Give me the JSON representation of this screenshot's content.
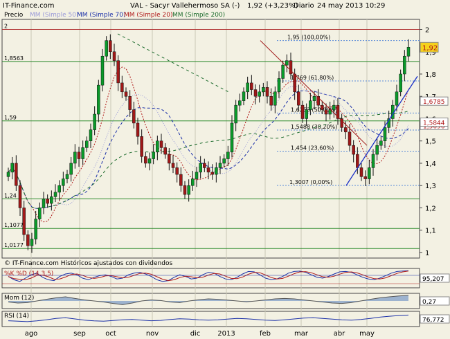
{
  "header": {
    "brand": "IT-Finance.com",
    "title": "VAL - Sacyr Vallehermoso SA (-)",
    "quote": "1,92 (+3,23%)",
    "period": "Diario",
    "date": "24 may 2013 10:29"
  },
  "legend": {
    "price": "Precio",
    "mm50": "MM (Simple 50)",
    "mm70": "MM (Simple 70)",
    "mm20": "MM (Simple 20)",
    "mm200": "MM (Simple 200)"
  },
  "colors": {
    "background": "#f3f1e3",
    "up": "#0a9a2a",
    "down": "#a01818",
    "mm50": "#9a9ad8",
    "mm70": "#1a2fa8",
    "mm20": "#b01818",
    "mm200": "#1c6b2c",
    "grid_red": "#b03030",
    "grid_green": "#2a8a2a",
    "support": "#1a2fc8",
    "price_tag": "#f6d21c"
  },
  "footer_note": "© IT-Finance.com  Históricos ajustados con dividendos",
  "chart_data": [
    {
      "type": "candlestick",
      "title": "VAL - Sacyr Vallehermoso SA (-)",
      "x_ticks": [
        "ago",
        "sep",
        "oct",
        "nov",
        "dic",
        "2013",
        "feb",
        "mar",
        "abr",
        "may"
      ],
      "y_ticks": [
        "2",
        "1,9",
        "1,8",
        "1,7",
        "1,6",
        "1,5",
        "1,4",
        "1,3",
        "1,2",
        "1,1",
        "1"
      ],
      "ylim": [
        0.975,
        2.045
      ],
      "last_price_label": "1,92",
      "level_labels": [
        {
          "label": "1,6785",
          "value": 1.6785
        },
        {
          "label": "1,5696",
          "value": 1.5696
        },
        {
          "label": "1,5844",
          "value": 1.5844
        }
      ],
      "horizontal_levels": [
        {
          "label": "2",
          "value": 2.0,
          "color": "#b03030"
        },
        {
          "label": "1,8563",
          "value": 1.8563,
          "color": "#2a8a2a"
        },
        {
          "label": "1,59",
          "value": 1.59,
          "color": "#2a8a2a"
        },
        {
          "label": "1,24",
          "value": 1.24,
          "color": "#2a8a2a"
        },
        {
          "label": "1,1077",
          "value": 1.1077,
          "color": "#2a8a2a"
        },
        {
          "label": "1,0177",
          "value": 1.0177,
          "color": "#2a8a2a"
        }
      ],
      "fibonacci": [
        {
          "label": "1,95 (100,00%)",
          "value": 1.95
        },
        {
          "label": "1,769 (61,80%)",
          "value": 1.769
        },
        {
          "label": "1,6253 (50,00%)",
          "value": 1.6253
        },
        {
          "label": "1,5488 (38,20%)",
          "value": 1.5488
        },
        {
          "label": "1,454 (23,60%)",
          "value": 1.454
        },
        {
          "label": "1,3007 (0,00%)",
          "value": 1.3007
        }
      ],
      "close_series": [
        1.36,
        1.4,
        1.3,
        1.2,
        1.08,
        1.03,
        1.06,
        1.15,
        1.2,
        1.24,
        1.22,
        1.25,
        1.27,
        1.3,
        1.33,
        1.35,
        1.4,
        1.45,
        1.42,
        1.47,
        1.5,
        1.55,
        1.62,
        1.75,
        1.88,
        1.95,
        1.9,
        1.86,
        1.76,
        1.72,
        1.7,
        1.64,
        1.58,
        1.52,
        1.43,
        1.4,
        1.42,
        1.45,
        1.5,
        1.47,
        1.44,
        1.4,
        1.38,
        1.35,
        1.3,
        1.26,
        1.3,
        1.33,
        1.36,
        1.4,
        1.38,
        1.36,
        1.35,
        1.38,
        1.4,
        1.42,
        1.45,
        1.58,
        1.66,
        1.68,
        1.72,
        1.76,
        1.73,
        1.7,
        1.72,
        1.74,
        1.7,
        1.66,
        1.72,
        1.78,
        1.84,
        1.86,
        1.8,
        1.72,
        1.66,
        1.6,
        1.64,
        1.68,
        1.7,
        1.66,
        1.64,
        1.62,
        1.64,
        1.66,
        1.6,
        1.56,
        1.54,
        1.48,
        1.44,
        1.38,
        1.34,
        1.33,
        1.38,
        1.44,
        1.48,
        1.5,
        1.56,
        1.6,
        1.66,
        1.72,
        1.8,
        1.88,
        1.92
      ]
    },
    {
      "type": "line",
      "title": "%K %D (14,3,5)",
      "series": [
        {
          "name": "%K"
        },
        {
          "name": "%D"
        }
      ],
      "last_value_label": "95,207",
      "values": [
        60,
        40,
        30,
        50,
        70,
        80,
        55,
        40,
        35,
        60,
        75,
        80,
        70,
        50,
        40,
        55,
        65,
        70,
        60,
        45,
        50,
        70,
        80,
        85,
        75,
        60,
        40,
        30,
        35,
        55,
        70,
        60,
        45,
        50,
        70,
        85,
        80,
        60,
        45,
        40,
        55,
        75,
        90,
        88,
        70,
        50,
        40,
        45,
        60,
        80,
        90,
        92,
        85,
        70,
        55,
        50,
        60,
        75,
        88,
        90,
        85,
        70,
        55,
        45,
        40,
        50,
        65,
        80,
        90,
        93,
        95
      ]
    },
    {
      "type": "area",
      "title": "Mom (12)",
      "series": [
        {
          "name": "Mom (12)"
        }
      ],
      "last_value_label": "0,27",
      "values": [
        -0.05,
        -0.1,
        -0.08,
        0.0,
        0.08,
        0.15,
        0.2,
        0.12,
        0.05,
        0.0,
        -0.05,
        -0.12,
        -0.18,
        -0.1,
        0.0,
        0.05,
        0.02,
        -0.05,
        -0.08,
        0.0,
        0.06,
        0.1,
        0.08,
        0.04,
        0.0,
        -0.04,
        0.0,
        0.05,
        0.1,
        0.12,
        0.1,
        0.05,
        0.0,
        -0.05,
        -0.1,
        -0.12,
        -0.08,
        0.0,
        0.08,
        0.15,
        0.2,
        0.24,
        0.27
      ]
    },
    {
      "type": "line",
      "title": "RSI (14)",
      "series": [
        {
          "name": "RSI (14)"
        }
      ],
      "last_value_label": "76,772",
      "values": [
        45,
        42,
        40,
        44,
        50,
        58,
        62,
        55,
        48,
        44,
        42,
        46,
        50,
        52,
        48,
        45,
        47,
        52,
        56,
        54,
        50,
        48,
        50,
        54,
        58,
        56,
        52,
        48,
        46,
        50,
        55,
        60,
        62,
        58,
        54,
        50,
        48,
        52,
        58,
        65,
        70,
        74,
        76.8
      ]
    }
  ]
}
